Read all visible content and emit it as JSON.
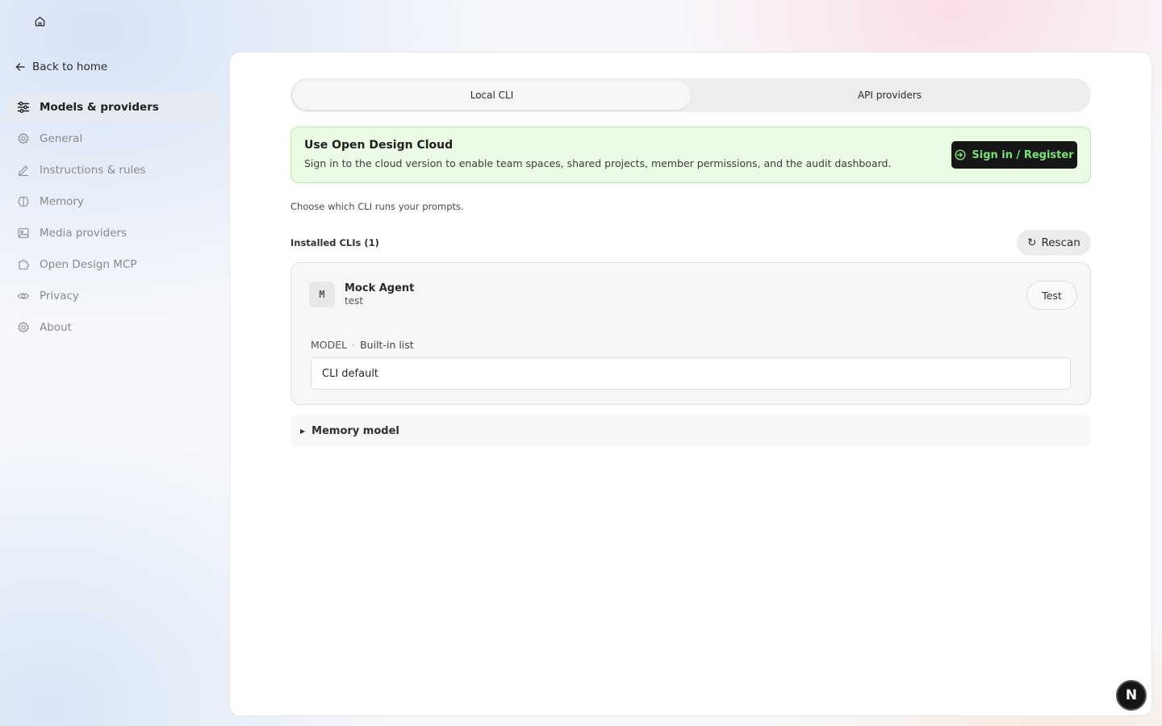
{
  "nav": {
    "home_icon": "home-icon",
    "back_label": "Back to home"
  },
  "sidebar": {
    "items": [
      {
        "label": "Models & providers",
        "icon": "sliders-icon",
        "active": true
      },
      {
        "label": "General",
        "icon": "gear-icon"
      },
      {
        "label": "Instructions & rules",
        "icon": "pencil-icon"
      },
      {
        "label": "Memory",
        "icon": "brain-icon"
      },
      {
        "label": "Media providers",
        "icon": "image-icon"
      },
      {
        "label": "Open Design MCP",
        "icon": "puzzle-icon"
      },
      {
        "label": "Privacy",
        "icon": "eye-icon"
      },
      {
        "label": "About",
        "icon": "gear-icon"
      }
    ]
  },
  "tabs": [
    {
      "label": "Local CLI",
      "active": true
    },
    {
      "label": "API providers",
      "active": false
    }
  ],
  "cloud_banner": {
    "title": "Use Open Design Cloud",
    "description": "Sign in to the cloud version to enable team spaces, shared projects, member permissions, and the audit dashboard.",
    "button_label": "Sign in / Register"
  },
  "helper_text": "Choose which CLI runs your prompts.",
  "installed": {
    "label": "Installed CLIs (1)",
    "rescan_label": "Rescan"
  },
  "agent": {
    "avatar": "M",
    "name": "Mock Agent",
    "subtitle": "test",
    "test_label": "Test",
    "model_label": "MODEL",
    "model_separator": "·",
    "model_source": "Built-in list",
    "model_value": "CLI default"
  },
  "memory_model": {
    "label": "Memory model"
  },
  "fab": {
    "label": "N"
  },
  "colors": {
    "banner_bg": "#e9fbe2",
    "banner_border": "#bfe9aa",
    "signin_bg": "#171717",
    "signin_text": "#7be07a"
  }
}
